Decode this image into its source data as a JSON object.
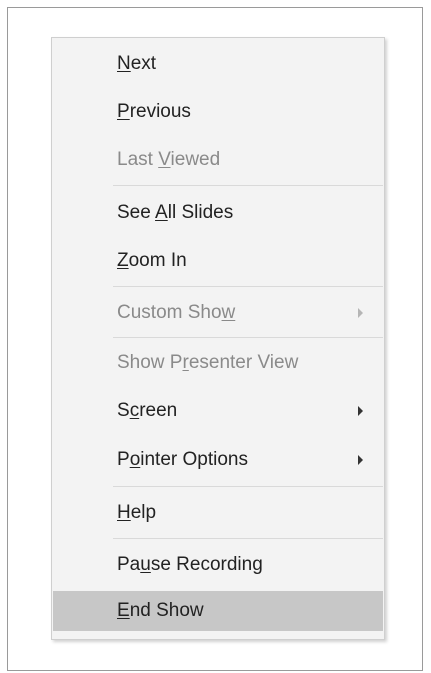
{
  "menu": {
    "items": [
      {
        "id": "next",
        "pre": "",
        "key": "N",
        "post": "ext",
        "disabled": false,
        "submenu": false,
        "highlight": false
      },
      {
        "id": "previous",
        "pre": "",
        "key": "P",
        "post": "revious",
        "disabled": false,
        "submenu": false,
        "highlight": false
      },
      {
        "id": "last-viewed",
        "pre": "Last ",
        "key": "V",
        "post": "iewed",
        "disabled": true,
        "submenu": false,
        "highlight": false
      },
      {
        "id": "see-all-slides",
        "pre": "See ",
        "key": "A",
        "post": "ll Slides",
        "disabled": false,
        "submenu": false,
        "highlight": false
      },
      {
        "id": "zoom-in",
        "pre": "",
        "key": "Z",
        "post": "oom In",
        "disabled": false,
        "submenu": false,
        "highlight": false
      },
      {
        "id": "custom-show",
        "pre": "Custom Sho",
        "key": "w",
        "post": "",
        "disabled": true,
        "submenu": true,
        "highlight": false
      },
      {
        "id": "show-presenter-view",
        "pre": "Show P",
        "key": "r",
        "post": "esenter View",
        "disabled": true,
        "submenu": false,
        "highlight": false
      },
      {
        "id": "screen",
        "pre": "S",
        "key": "c",
        "post": "reen",
        "disabled": false,
        "submenu": true,
        "highlight": false
      },
      {
        "id": "pointer-options",
        "pre": "P",
        "key": "o",
        "post": "inter Options",
        "disabled": false,
        "submenu": true,
        "highlight": false
      },
      {
        "id": "help",
        "pre": "",
        "key": "H",
        "post": "elp",
        "disabled": false,
        "submenu": false,
        "highlight": false
      },
      {
        "id": "pause-recording",
        "pre": "Pa",
        "key": "u",
        "post": "se Recording",
        "disabled": false,
        "submenu": false,
        "highlight": false
      },
      {
        "id": "end-show",
        "pre": "",
        "key": "E",
        "post": "nd Show",
        "disabled": false,
        "submenu": false,
        "highlight": true
      }
    ]
  }
}
